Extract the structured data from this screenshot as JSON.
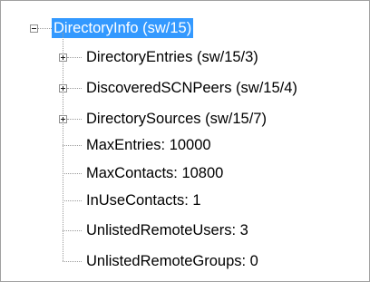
{
  "tree": {
    "root": {
      "label": "DirectoryInfo (sw/15)",
      "selected": true,
      "expanded": true
    },
    "children": [
      {
        "label": "DirectoryEntries (sw/15/3)",
        "expandable": true,
        "expanded": false
      },
      {
        "label": "DiscoveredSCNPeers (sw/15/4)",
        "expandable": true,
        "expanded": false
      },
      {
        "label": "DirectorySources (sw/15/7)",
        "expandable": true,
        "expanded": false
      },
      {
        "label": "MaxEntries: 10000",
        "expandable": false
      },
      {
        "label": "MaxContacts: 10800",
        "expandable": false
      },
      {
        "label": "InUseContacts: 1",
        "expandable": false
      },
      {
        "label": "UnlistedRemoteUsers: 3",
        "expandable": false
      },
      {
        "label": "UnlistedRemoteGroups: 0",
        "expandable": false
      }
    ]
  },
  "colors": {
    "selection_background": "#3399ff",
    "selection_text": "#ffffff",
    "connector_lines": "#9a9a9a",
    "border": "#a0a0a0"
  }
}
